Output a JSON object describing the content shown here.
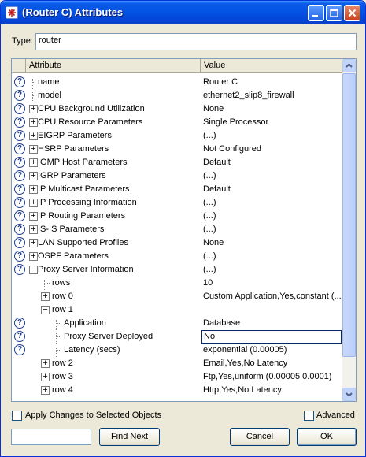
{
  "window": {
    "title": "(Router C) Attributes"
  },
  "type_field": {
    "label": "Type:",
    "value": "router"
  },
  "grid": {
    "headers": {
      "attribute": "Attribute",
      "value": "Value"
    },
    "rows": [
      {
        "label": "name",
        "value": "Router C",
        "help": true,
        "level": 0,
        "expander": "none"
      },
      {
        "label": "model",
        "value": "ethernet2_slip8_firewall",
        "help": true,
        "level": 0,
        "expander": "none"
      },
      {
        "label": "CPU Background Utilization",
        "value": "None",
        "help": true,
        "level": 0,
        "expander": "plus"
      },
      {
        "label": "CPU Resource Parameters",
        "value": "Single Processor",
        "help": true,
        "level": 0,
        "expander": "plus"
      },
      {
        "label": "EIGRP Parameters",
        "value": "(...)",
        "help": true,
        "level": 0,
        "expander": "plus"
      },
      {
        "label": "HSRP Parameters",
        "value": "Not Configured",
        "help": true,
        "level": 0,
        "expander": "plus"
      },
      {
        "label": "IGMP Host Parameters",
        "value": "Default",
        "help": true,
        "level": 0,
        "expander": "plus"
      },
      {
        "label": "IGRP Parameters",
        "value": "(...)",
        "help": true,
        "level": 0,
        "expander": "plus"
      },
      {
        "label": "IP Multicast Parameters",
        "value": "Default",
        "help": true,
        "level": 0,
        "expander": "plus"
      },
      {
        "label": "IP Processing Information",
        "value": "(...)",
        "help": true,
        "level": 0,
        "expander": "plus"
      },
      {
        "label": "IP Routing Parameters",
        "value": "(...)",
        "help": true,
        "level": 0,
        "expander": "plus"
      },
      {
        "label": "IS-IS Parameters",
        "value": "(...)",
        "help": true,
        "level": 0,
        "expander": "plus"
      },
      {
        "label": "LAN Supported Profiles",
        "value": "None",
        "help": true,
        "level": 0,
        "expander": "plus"
      },
      {
        "label": "OSPF Parameters",
        "value": "(...)",
        "help": true,
        "level": 0,
        "expander": "plus"
      },
      {
        "label": "Proxy Server Information",
        "value": "(...)",
        "help": true,
        "level": 0,
        "expander": "minus"
      },
      {
        "label": "rows",
        "value": "10",
        "help": false,
        "level": 1,
        "expander": "none"
      },
      {
        "label": "row 0",
        "value": "Custom Application,Yes,constant (...",
        "help": false,
        "level": 1,
        "expander": "plus"
      },
      {
        "label": "row 1",
        "value": "",
        "help": false,
        "level": 1,
        "expander": "minus"
      },
      {
        "label": "Application",
        "value": "Database",
        "help": true,
        "level": 2,
        "expander": "none"
      },
      {
        "label": "Proxy Server Deployed",
        "value": "No",
        "help": true,
        "level": 2,
        "expander": "none",
        "selected": true
      },
      {
        "label": "Latency (secs)",
        "value": "exponential (0.00005)",
        "help": true,
        "level": 2,
        "expander": "none"
      },
      {
        "label": "row 2",
        "value": "Email,Yes,No Latency",
        "help": false,
        "level": 1,
        "expander": "plus"
      },
      {
        "label": "row 3",
        "value": "Ftp,Yes,uniform (0.00005 0.0001)",
        "help": false,
        "level": 1,
        "expander": "plus"
      },
      {
        "label": "row 4",
        "value": "Http,Yes,No Latency",
        "help": false,
        "level": 1,
        "expander": "plus"
      }
    ]
  },
  "footer": {
    "apply_changes_label": "Apply Changes to Selected Objects",
    "advanced_label": "Advanced",
    "find_next_label": "Find Next",
    "cancel_label": "Cancel",
    "ok_label": "OK"
  },
  "colors": {
    "titlebar": "#0455e6",
    "selection_border": "#0a246a",
    "help_icon": "#1b3c8c"
  }
}
